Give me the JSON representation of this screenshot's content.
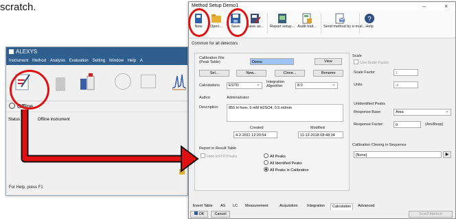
{
  "caption": "scratch.",
  "alexys": {
    "title": "ALEXYS",
    "menu": [
      "Instrument",
      "Method",
      "Analysis",
      "Evaluation",
      "Setting",
      "Window",
      "Help",
      "A"
    ],
    "status": "Offline",
    "table_col1": "Status",
    "table_col2": "Offline instrument",
    "footer": "For Help, press F1"
  },
  "dialog": {
    "title": "Method Setup Demo1",
    "controls": {
      "min": "–",
      "close": "×"
    },
    "ribbon": [
      {
        "label": "New",
        "icon": "new-file-icon"
      },
      {
        "label": "Open...",
        "icon": "open-folder-icon"
      },
      {
        "label": "Save",
        "icon": "save-icon"
      },
      {
        "label": "Save as...",
        "icon": "save-as-icon"
      },
      {
        "label": "Report setup...",
        "icon": "report-icon"
      },
      {
        "label": "Audit trail...",
        "icon": "audit-icon"
      },
      {
        "label": "Send method by e-mail...",
        "icon": "mail-icon"
      },
      {
        "label": "Help",
        "icon": "help-icon"
      }
    ],
    "common_label": "Common for all detectors",
    "calibration_file_label": "Calibration File (Peak Table)",
    "calibration_file_value": "Demo",
    "view_label": "View",
    "buttons": [
      "Sel...",
      "New...",
      "Clone...",
      "Rename"
    ],
    "calculations_label": "Calculations",
    "calculations_value": "ESTD",
    "integration_label": "Integration Algorithm",
    "integration_value": "8.0",
    "author_label": "Author",
    "author_value": "Administrator",
    "description_label": "Description",
    "description_value": "855 H form, 9 mM H2SO4, 0.5 ml/min",
    "created_label": "Created",
    "created_value": "4-2-2011 12:20:54",
    "modified_label": "Modified",
    "modified_value": "11-12-2018 08:48:34",
    "report_group": "Report in Result Table",
    "hide_estd": "Hide ESTD Peaks",
    "radios": [
      "All Peaks",
      "All Identified Peaks",
      "All Peaks in Calibration"
    ],
    "scale_group": "Scale",
    "use_scale": "Use Scale Factor",
    "scale_factor_label": "Scale Factor",
    "scale_factor_value": "1",
    "units_label": "Units",
    "units_value": "ul",
    "unidentified_group": "Unidentified Peaks",
    "response_base_label": "Response Base:",
    "response_base_value": "Area",
    "response_factor_label": "Response Factor:",
    "response_factor_value": "0",
    "response_factor_unit": "(Am/Resp)",
    "cal_clone_group": "Calibration Cloning in Sequence",
    "cal_clone_value": "[None]",
    "tabs": [
      "Event Table",
      "AS",
      "LC",
      "Measurement",
      "Acquisition",
      "Integration",
      "Calculation",
      "Advanced"
    ],
    "active_tab": "Calculation",
    "ok_label": "OK",
    "cancel_label": "Cancel",
    "scroll_label": "Scroll Method"
  }
}
